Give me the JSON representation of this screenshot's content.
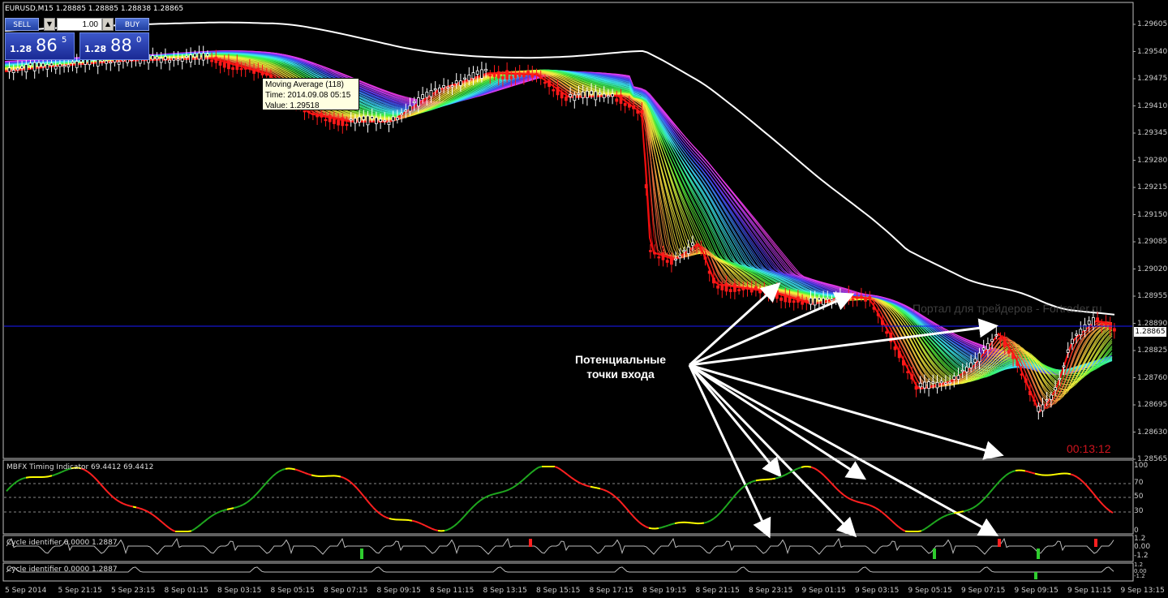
{
  "window": {
    "symbol_line": "EURUSD,M15  1.28885 1.28885 1.28838 1.28865"
  },
  "oneclick": {
    "sell_label": "SELL",
    "buy_label": "BUY",
    "lot_value": "1.00",
    "sell_price_small": "1.28",
    "sell_price_large": "86",
    "sell_price_sup": "5",
    "buy_price_small": "1.28",
    "buy_price_large": "88",
    "buy_price_sup": "0",
    "spin_down": "▼",
    "spin_up": "▲"
  },
  "tooltip": {
    "line1": "Moving Average (118)",
    "line2": "Time: 2014.09.08 05:15",
    "line3": "Value: 1.29518"
  },
  "annotation": {
    "line1": "Потенциальные",
    "line2": "точки входа"
  },
  "timer": "00:13:12",
  "watermark": "Портал для трейдеров - Fortrader.ru",
  "price_axis": {
    "labels": [
      "1.29605",
      "1.29540",
      "1.29475",
      "1.29410",
      "1.29345",
      "1.29280",
      "1.29215",
      "1.29150",
      "1.29085",
      "1.29020",
      "1.28955",
      "1.28890",
      "1.28825",
      "1.28760",
      "1.28695",
      "1.28630",
      "1.28565"
    ],
    "current_price": "1.28865"
  },
  "time_axis": {
    "labels": [
      "5 Sep 2014",
      "5 Sep 21:15",
      "5 Sep 23:15",
      "8 Sep 01:15",
      "8 Sep 03:15",
      "8 Sep 05:15",
      "8 Sep 07:15",
      "8 Sep 09:15",
      "8 Sep 11:15",
      "8 Sep 13:15",
      "8 Sep 15:15",
      "8 Sep 17:15",
      "8 Sep 19:15",
      "8 Sep 21:15",
      "8 Sep 23:15",
      "9 Sep 01:15",
      "9 Sep 03:15",
      "9 Sep 05:15",
      "9 Sep 07:15",
      "9 Sep 09:15",
      "9 Sep 11:15",
      "9 Sep 13:15"
    ]
  },
  "indicators": {
    "mbfx": {
      "label": "MBFX Timing Indicator 69.4412 69.4412",
      "levels": [
        "100",
        "70",
        "50",
        "30",
        "0"
      ]
    },
    "cycle1": {
      "label": "Cycle identifier 0.0000 1.2887",
      "levels": [
        "1.2",
        "0.00",
        "-1.2"
      ]
    },
    "cycle2": {
      "label": "Cycle identifier 0.0000 1.2887",
      "levels": [
        "1.2",
        "0.00",
        "-1.2"
      ]
    }
  },
  "colors": {
    "background": "#000000",
    "bull_candle": "#ffffff",
    "bear_candle": "#ff0000",
    "current_price_line": "#1a1aff",
    "annotation_arrow": "#ffffff"
  }
}
